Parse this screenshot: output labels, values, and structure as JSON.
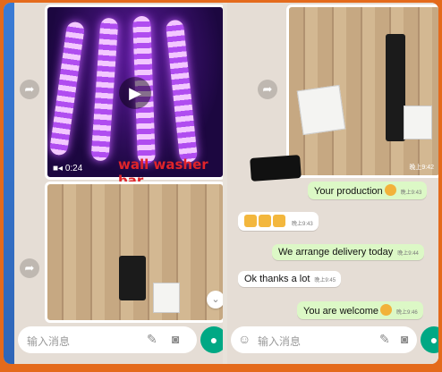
{
  "colors": {
    "frame_border": "#e46a1c",
    "outgoing_bubble": "#dcf8c6",
    "incoming_bubble": "#ffffff",
    "chat_background": "#e5ddd5",
    "mic_button": "#00a884",
    "annotation_text": "#e0242a"
  },
  "left_chat": {
    "video": {
      "duration": "0:24",
      "play_icon": "play-icon",
      "camera_icon": "video-camera-icon"
    },
    "annotation": "wall washer bar",
    "photo_icon": "scroll-down-chevron-icon",
    "composer": {
      "placeholder": "输入消息",
      "attach_icon": "paperclip-icon",
      "camera_icon": "camera-icon",
      "mic_icon": "microphone-icon"
    }
  },
  "right_chat": {
    "image_time": "晚上9:42",
    "messages": [
      {
        "text": "Your production",
        "time": "晚上9:43",
        "direction": "out",
        "emoji": "grinning-face"
      },
      {
        "text": "",
        "time": "晚上9:43",
        "direction": "in",
        "emoji": "thumbs-up x3"
      },
      {
        "text": "We arrange delivery today",
        "time": "晚上9:44",
        "direction": "out"
      },
      {
        "text": "Ok thanks a lot",
        "time": "晚上9:45",
        "direction": "in"
      },
      {
        "text": "You are welcome",
        "time": "晚上9:46",
        "direction": "out",
        "emoji": "grinning-face"
      }
    ],
    "composer": {
      "placeholder": "输入消息",
      "emoji_icon": "emoji-icon",
      "attach_icon": "paperclip-icon",
      "camera_icon": "camera-icon"
    }
  }
}
